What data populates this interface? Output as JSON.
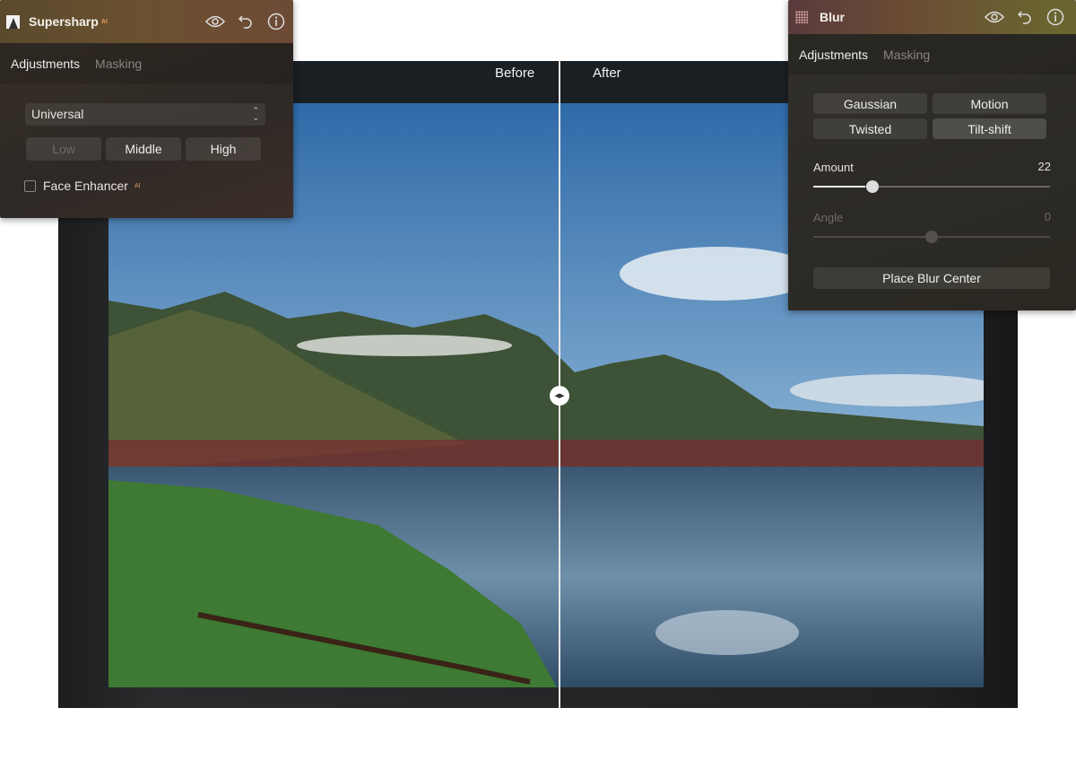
{
  "compare": {
    "before_label": "Before",
    "after_label": "After"
  },
  "supersharp": {
    "title": "Supersharp",
    "ai_badge": "AI",
    "tabs": [
      {
        "label": "Adjustments",
        "active": true
      },
      {
        "label": "Masking",
        "active": false
      }
    ],
    "mode_select": "Universal",
    "levels": [
      {
        "label": "Low",
        "disabled": true
      },
      {
        "label": "Middle"
      },
      {
        "label": "High"
      }
    ],
    "face_enhancer": {
      "label": "Face Enhancer",
      "badge": "AI",
      "checked": false
    }
  },
  "blur": {
    "title": "Blur",
    "tabs": [
      {
        "label": "Adjustments",
        "active": true
      },
      {
        "label": "Masking",
        "active": false
      }
    ],
    "types": [
      {
        "label": "Gaussian"
      },
      {
        "label": "Motion"
      },
      {
        "label": "Twisted"
      },
      {
        "label": "Tilt-shift",
        "selected": true
      }
    ],
    "amount": {
      "label": "Amount",
      "value": "22",
      "fraction": 0.22
    },
    "angle": {
      "label": "Angle",
      "value": "0",
      "fraction": 0.5,
      "disabled": true
    },
    "place_center_label": "Place Blur Center"
  }
}
